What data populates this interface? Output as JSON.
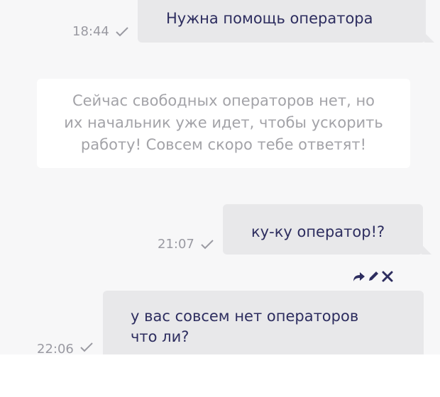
{
  "messages": [
    {
      "text": "Нужна помощь оператора",
      "time": "18:44"
    },
    {
      "text": "ку-ку оператор!?",
      "time": "21:07"
    },
    {
      "text_line1": "у вас совсем нет операторов",
      "text_line2": "что ли?",
      "time": "22:06"
    }
  ],
  "system_message": {
    "line1": "Сейчас свободных операторов нет, но",
    "line2": "их начальник уже идет, чтобы ускорить",
    "line3": "работу! Совсем скоро тебе ответят!"
  },
  "colors": {
    "bubble": "#e8e8ea",
    "text": "#2d2d5f",
    "meta": "#9a9aa2",
    "system_text": "#a3a3a8",
    "background": "#f7f7f8"
  },
  "icons": {
    "status": "checkmark-icon",
    "actions": [
      "forward-icon",
      "edit-icon",
      "delete-icon"
    ]
  }
}
